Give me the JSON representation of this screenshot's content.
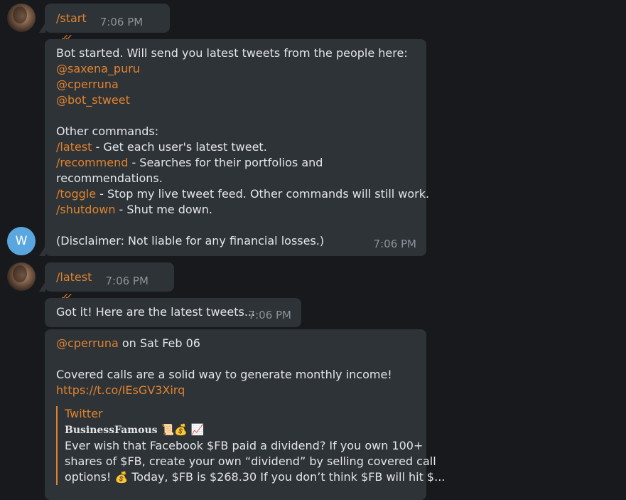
{
  "messages": {
    "m1": {
      "text": "/start",
      "time": "7:06 PM",
      "ticks": "✓✓"
    },
    "m2": {
      "intro": "Bot started. Will send you latest tweets from the people here:",
      "users": [
        "@saxena_puru",
        "@cperruna",
        "@bot_stweet"
      ],
      "commands_header": "Other commands:",
      "commands": [
        {
          "cmd": "/latest",
          "desc": " - Get each user's latest tweet."
        },
        {
          "cmd": "/recommend",
          "desc": " - Searches for their portfolios and"
        },
        {
          "cmd": "/toggle",
          "desc": " - Stop my live tweet feed. Other commands will still work."
        },
        {
          "cmd": "/shutdown",
          "desc": " - Shut me down."
        }
      ],
      "recommend_cont": "recommendations.",
      "disclaimer": "(Disclaimer: Not liable for any financial losses.)",
      "time": "7:06 PM",
      "avatar_letter": "W"
    },
    "m3": {
      "text": "/latest",
      "time": "7:06 PM",
      "ticks": "✓✓"
    },
    "m4": {
      "text": "Got it! Here are the latest tweets...",
      "time": "7:06 PM"
    },
    "m5": {
      "user": "@cperruna",
      "date": " on Sat Feb 06",
      "body": "Covered calls are a solid way to generate monthly income!",
      "link": "https://t.co/IEsGV3Xirq",
      "preview": {
        "site": "Twitter",
        "author": "BusinessFamous",
        "author_emojis": "📜💰 📈",
        "lines": [
          "Ever wish that Facebook $FB paid a dividend? If you own 100+",
          "shares of $FB, create your own “dividend” by selling covered call"
        ],
        "line3a": "options! ",
        "line3_emoji": "💰",
        "line3b": " Today, $FB is $268.30 If you don’t think $FB will hit $..."
      }
    }
  }
}
